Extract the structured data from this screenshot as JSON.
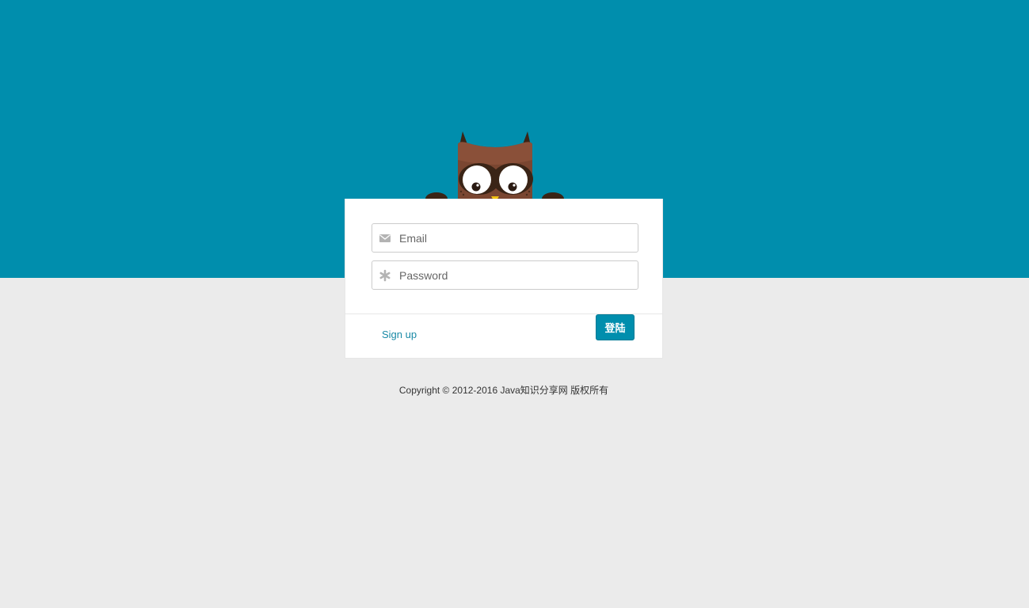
{
  "login_form": {
    "email_placeholder": "Email",
    "password_placeholder": "Password",
    "signup_label": "Sign up",
    "submit_label": "登陆"
  },
  "footer": {
    "copyright": "Copyright © 2012-2016 Java知识分享网 版权所有"
  },
  "icons": {
    "email": "envelope-icon",
    "password": "asterisk-icon",
    "mascot": "owl-mascot"
  },
  "colors": {
    "brand": "#008ead",
    "background": "#ebebeb",
    "link": "#1a8aa6"
  }
}
